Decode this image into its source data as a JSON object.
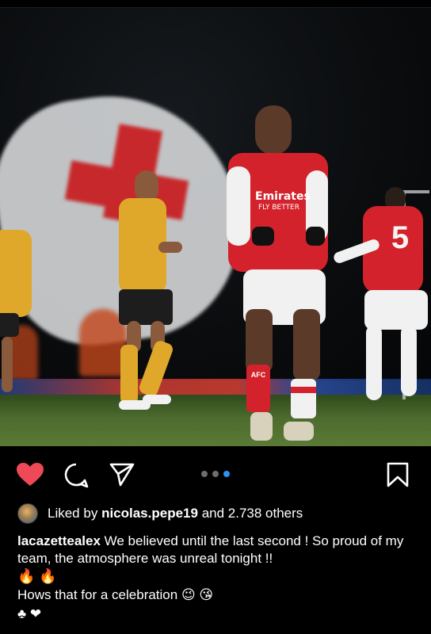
{
  "post": {
    "liked_by_prefix": "Liked by",
    "liked_by_user": "nicolas.pepe19",
    "liked_by_suffix": "and 2.738 others",
    "caption_user": "lacazettealex",
    "caption_text": "We believed until the last second ! So proud of my team, the atmosphere was unreal tonight !!",
    "caption_emojis": "🔥 🔥",
    "comment_line": "Hows that for a celebration",
    "comment_emojis": "😉 😘",
    "suit_line": "♣ ❤"
  },
  "photo": {
    "shirt_sponsor_line1": "Emirates",
    "shirt_sponsor_line2": "FLY BETTER",
    "sock_text": "AFC",
    "back_number": "5"
  },
  "carousel": {
    "total": 3,
    "active_index": 2
  },
  "icons": {
    "like": "heart-icon",
    "comment": "comment-bubble-icon",
    "share": "paper-plane-icon",
    "save": "bookmark-icon"
  },
  "colors": {
    "like_red": "#ed4956",
    "dot_active": "#2a95f5",
    "dot_inactive": "#6e6e6e",
    "background": "#000000",
    "text": "#ffffff"
  }
}
